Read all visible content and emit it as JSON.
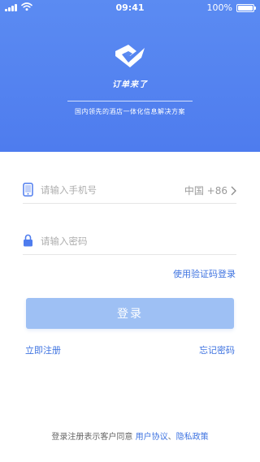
{
  "status_bar": {
    "time": "09:41",
    "battery_text": "100%"
  },
  "brand": {
    "name": "订单来了",
    "tagline": "国内领先的酒店一体化信息解决方案"
  },
  "form": {
    "phone_placeholder": "请输入手机号",
    "country_code": "中国 +86",
    "password_placeholder": "请输入密码",
    "sms_login_label": "使用验证码登录",
    "login_label": "登录",
    "register_label": "立即注册",
    "forgot_label": "忘记密码"
  },
  "agreement": {
    "prefix": "登录注册表示客户同意 ",
    "user_agreement": "用户协议",
    "separator": "、",
    "privacy_policy": "隐私政策"
  },
  "colors": {
    "primary": "#4e7cee",
    "link": "#3e73e0",
    "button_disabled": "#9ec0f4"
  },
  "icons": [
    "signal-icon",
    "wifi-icon",
    "battery-icon",
    "logo-icon",
    "phone-icon",
    "lock-icon",
    "chevron-right-icon"
  ]
}
